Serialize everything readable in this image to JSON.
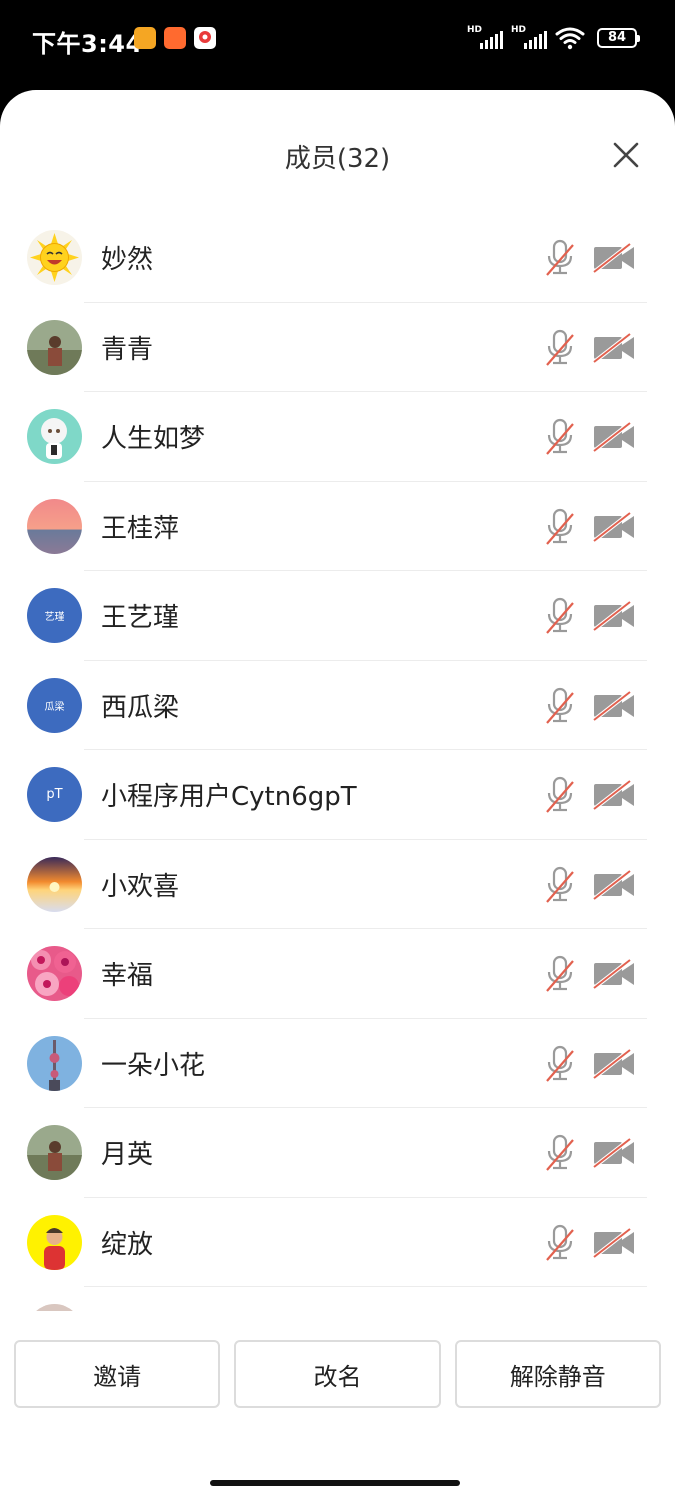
{
  "status_bar": {
    "time": "下午3:44",
    "signal1_label": "HD",
    "signal2_label": "HD",
    "battery": "84"
  },
  "sheet": {
    "title": "成员(32)"
  },
  "members": [
    {
      "name": "妙然",
      "avatar_type": "image",
      "avatar_desc": "sun-emoji",
      "mic": "muted",
      "camera": "off"
    },
    {
      "name": "青青",
      "avatar_type": "image",
      "avatar_desc": "photo",
      "mic": "muted",
      "camera": "off"
    },
    {
      "name": "人生如梦",
      "avatar_type": "image",
      "avatar_desc": "cartoon",
      "mic": "muted",
      "camera": "off"
    },
    {
      "name": "王桂萍",
      "avatar_type": "image",
      "avatar_desc": "sunset",
      "mic": "muted",
      "camera": "off"
    },
    {
      "name": "王艺瑾",
      "avatar_type": "text",
      "avatar_text": "艺瑾",
      "mic": "muted",
      "camera": "off"
    },
    {
      "name": "西瓜梁",
      "avatar_type": "text",
      "avatar_text": "瓜梁",
      "mic": "muted",
      "camera": "off"
    },
    {
      "name": "小程序用户Cytn6gpT",
      "avatar_type": "text",
      "avatar_text": "pT",
      "mic": "muted",
      "camera": "off"
    },
    {
      "name": "小欢喜",
      "avatar_type": "image",
      "avatar_desc": "sunrise",
      "mic": "muted",
      "camera": "off"
    },
    {
      "name": "幸福",
      "avatar_type": "image",
      "avatar_desc": "roses",
      "mic": "muted",
      "camera": "off"
    },
    {
      "name": "一朵小花",
      "avatar_type": "image",
      "avatar_desc": "tower",
      "mic": "muted",
      "camera": "off"
    },
    {
      "name": "月英",
      "avatar_type": "image",
      "avatar_desc": "photo",
      "mic": "muted",
      "camera": "off"
    },
    {
      "name": "绽放",
      "avatar_type": "image",
      "avatar_desc": "yellow-portrait",
      "mic": "muted",
      "camera": "off"
    }
  ],
  "actions": {
    "invite": "邀请",
    "rename": "改名",
    "unmute": "解除静音"
  },
  "colors": {
    "avatar_blue": "#3d6bbf",
    "mute_red": "#e2614f",
    "icon_gray": "#9a9a9a"
  }
}
